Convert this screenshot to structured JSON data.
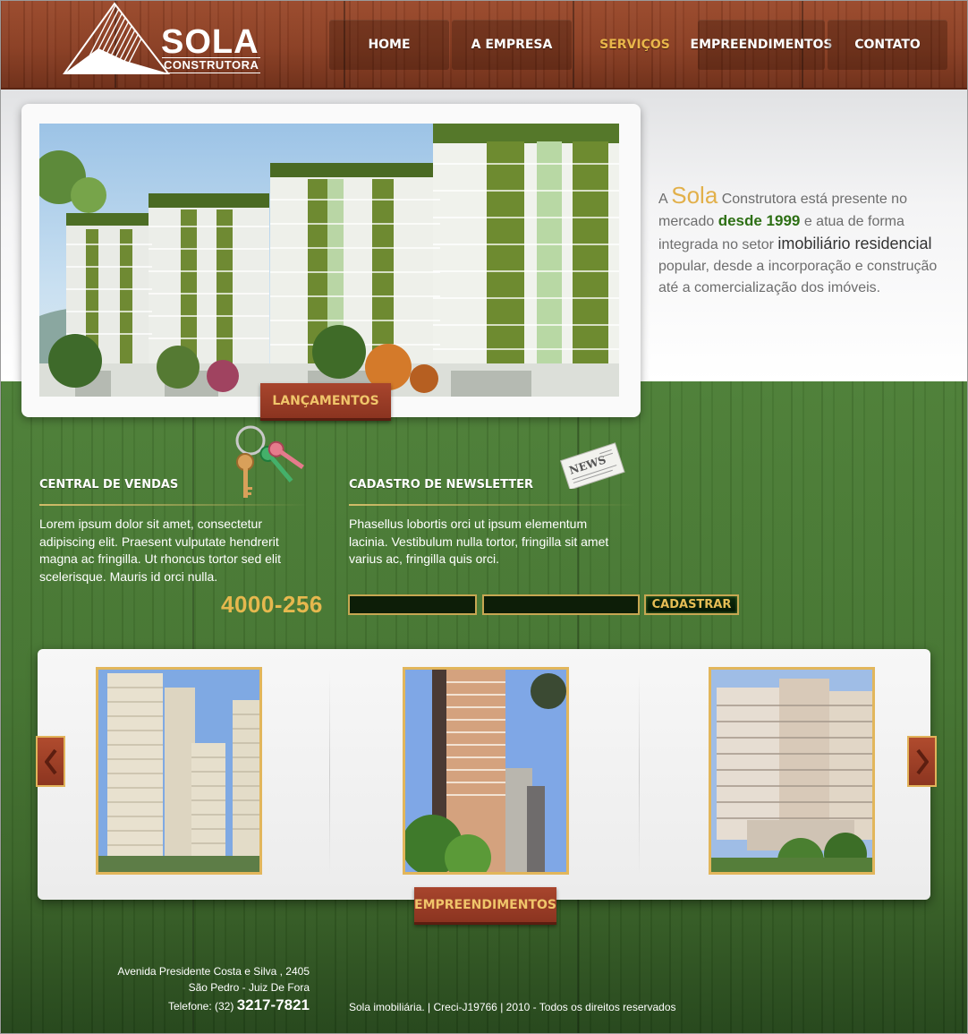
{
  "brand": {
    "name": "SOLA",
    "subtitle": "CONSTRUTORA"
  },
  "nav": [
    {
      "label": "HOME",
      "active": false
    },
    {
      "label": "A EMPRESA",
      "active": false
    },
    {
      "label": "SERVIÇOS",
      "active": true
    },
    {
      "label": "EMPREENDIMENTOS",
      "active": false
    },
    {
      "label": "CONTATO",
      "active": false
    }
  ],
  "hero": {
    "badge": "LANÇAMENTOS"
  },
  "intro": {
    "a": "A ",
    "brand": "Sola",
    "part1": " Construtora está presente no mercado ",
    "since": "desde 1999",
    "part2": " e atua de forma integrada no setor ",
    "sector": "imobiliário residencial",
    "part3": " popular, desde a incorporação e construção até a comercialização dos imóveis."
  },
  "sales": {
    "title": "CENTRAL DE VENDAS",
    "text": "Lorem ipsum dolor sit amet, consectetur adipiscing elit. Praesent vulputate hendrerit magna ac fringilla. Ut rhoncus tortor sed elit scelerisque. Mauris id orci nulla.",
    "phone": "4000-256"
  },
  "newsletter": {
    "title": "CADASTRO DE NEWSLETTER",
    "text": "Phasellus lobortis orci ut ipsum elementum lacinia. Vestibulum nulla tortor, fringilla sit amet varius ac, fringilla quis orci.",
    "button": "CADASTRAR",
    "name_value": "",
    "email_value": ""
  },
  "carousel": {
    "badge": "EMPREENDIMENTOS"
  },
  "footer": {
    "address_line1": "Avenida Presidente Costa e Silva ,  2405",
    "address_line2": "São Pedro  - Juiz De Fora",
    "phone_label": "Telefone: (32) ",
    "phone_number": "3217-7821",
    "copyright": "Sola imobiliária. | Creci-J19766 | 2010 - Todos os direitos reservados"
  },
  "colors": {
    "wood_red": "#8a3e23",
    "wood_green": "#457531",
    "gold": "#e2b04a",
    "green_text": "#2d6f14"
  },
  "icons": {
    "keys": "keys-icon",
    "newspaper": "newspaper-icon",
    "prev": "chevron-left-icon",
    "next": "chevron-right-icon"
  }
}
